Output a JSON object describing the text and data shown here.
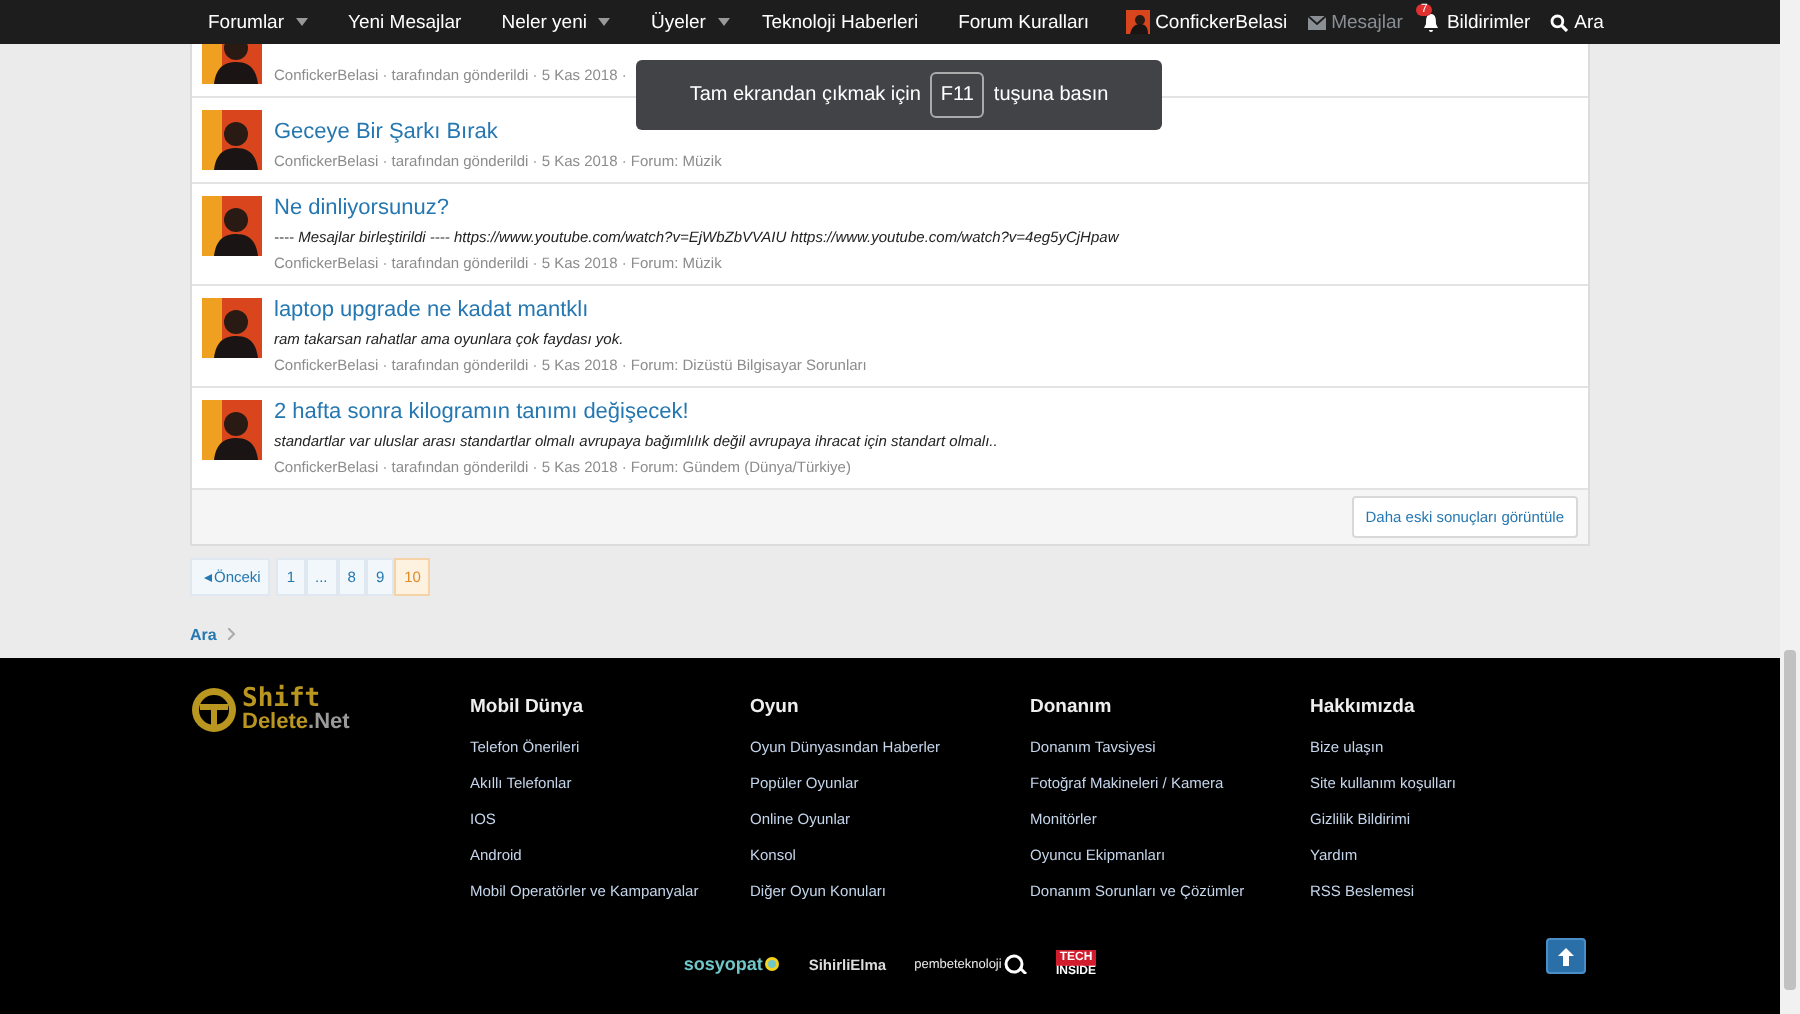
{
  "nav": {
    "items": [
      {
        "label": "Forumlar",
        "dropdown": true
      },
      {
        "label": "Yeni Mesajlar",
        "dropdown": false
      },
      {
        "label": "Neler yeni",
        "dropdown": true
      },
      {
        "label": "Üyeler",
        "dropdown": true
      },
      {
        "label": "Teknoloji Haberleri",
        "dropdown": false
      },
      {
        "label": "Forum Kuralları",
        "dropdown": false
      }
    ],
    "user": {
      "label": "ConfickerBelasi"
    },
    "actions": [
      {
        "kind": "messages",
        "label": "Mesajlar",
        "disabled": true
      },
      {
        "kind": "alerts",
        "label": "Bildirimler",
        "disabled": false,
        "badge": "7"
      },
      {
        "kind": "search",
        "label": "Ara",
        "disabled": false
      }
    ]
  },
  "fullscreen_notice": {
    "before": "Tam ekrandan çıkmak için",
    "key": "F11",
    "after": "tuşuna basın"
  },
  "results": [
    {
      "meta": "ConfickerBelasi · tarafından gönderildi · 5 Kas 2018 ·"
    },
    {
      "title": "Geceye Bir Şarkı Bırak",
      "meta": "ConfickerBelasi · tarafından gönderildi · 5 Kas 2018 · Forum: Müzik"
    },
    {
      "title": "Ne dinliyorsunuz?",
      "snippet": "---- Mesajlar birleştirildi ---- https://www.youtube.com/watch?v=EjWbZbVVAIU https://www.youtube.com/watch?v=4eg5yCjHpaw",
      "meta": "ConfickerBelasi · tarafından gönderildi · 5 Kas 2018 · Forum: Müzik"
    },
    {
      "title": "laptop upgrade ne kadat mantklı",
      "snippet": "ram takarsan rahatlar ama oyunlara çok faydası yok.",
      "meta": "ConfickerBelasi · tarafından gönderildi · 5 Kas 2018 · Forum: Dizüstü Bilgisayar Sorunları"
    },
    {
      "title": "2 hafta sonra kilogramın tanımı değişecek!",
      "snippet": "standartlar var uluslar arası standartlar olmalı avrupaya bağımlılık değil avrupaya ihracat için standart olmalı..",
      "meta": "ConfickerBelasi · tarafından gönderildi · 5 Kas 2018 · Forum: Gündem (Dünya/Türkiye)"
    }
  ],
  "older_button": "Daha eski sonuçları görüntüle",
  "pagination": {
    "prev": "Önceki",
    "pages": [
      {
        "label": "1",
        "selected": false
      },
      {
        "label": "...",
        "selected": false
      },
      {
        "label": "8",
        "selected": false
      },
      {
        "label": "9",
        "selected": false
      },
      {
        "label": "10",
        "selected": true
      }
    ]
  },
  "breadcrumb": [
    "Ara"
  ],
  "footer": {
    "logo": {
      "top": "Shift",
      "bottom": "Delete",
      "suffix": ".Net"
    },
    "columns": [
      {
        "heading": "Mobil Dünya",
        "links": [
          "Telefon Önerileri",
          "Akıllı Telefonlar",
          "IOS",
          "Android",
          "Mobil Operatörler ve Kampanyalar"
        ]
      },
      {
        "heading": "Oyun",
        "links": [
          "Oyun Dünyasından Haberler",
          "Popüler Oyunlar",
          "Online Oyunlar",
          "Konsol",
          "Diğer Oyun Konuları"
        ]
      },
      {
        "heading": "Donanım",
        "links": [
          "Donanım Tavsiyesi",
          "Fotoğraf Makineleri / Kamera",
          "Monitörler",
          "Oyuncu Ekipmanları",
          "Donanım Sorunları ve Çözümler"
        ]
      },
      {
        "heading": "Hakkımızda",
        "links": [
          "Bize ulaşın",
          "Site kullanım koşulları",
          "Gizlilik Bildirimi",
          "Yardım",
          "RSS Beslemesi"
        ]
      }
    ],
    "partners": [
      {
        "kind": "sosyopat",
        "label": "sosyopat"
      },
      {
        "kind": "plain",
        "label": "SihirliElma"
      },
      {
        "kind": "pembe",
        "label": "pembeteknoloji"
      },
      {
        "kind": "tech",
        "top": "TECH",
        "bottom": "INSIDE"
      }
    ]
  }
}
